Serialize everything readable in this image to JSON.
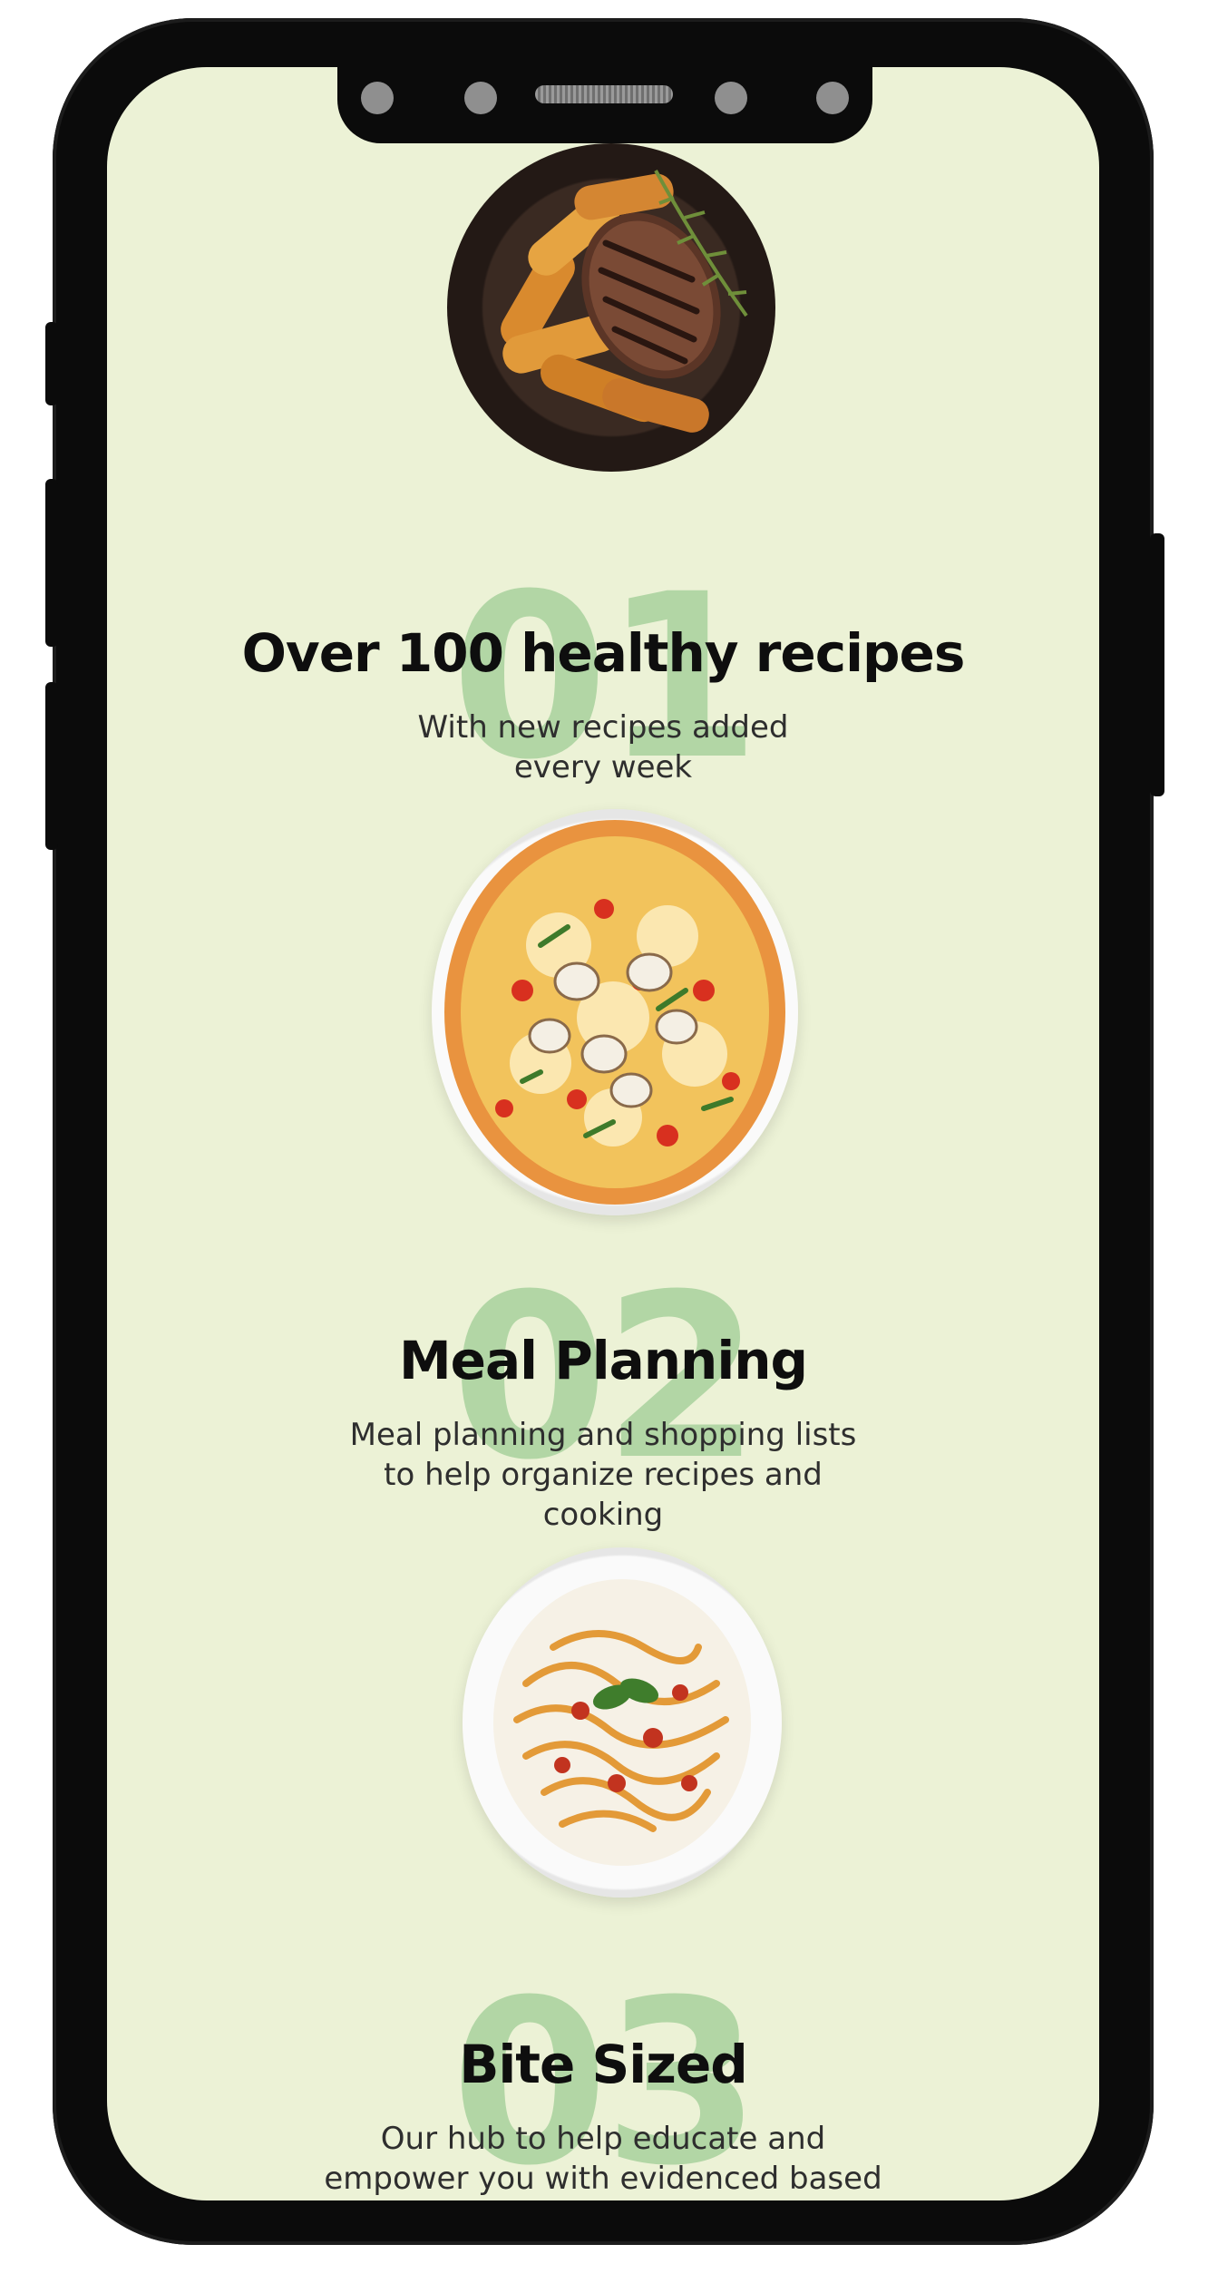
{
  "features": [
    {
      "number": "01",
      "title": "Over 100 healthy recipes",
      "description": "With new recipes added every week",
      "image": "steak-potatoes-dish"
    },
    {
      "number": "02",
      "title": "Meal Planning",
      "description": "Meal planning and shopping lists to help organize recipes and cooking",
      "image": "pizza-dish"
    },
    {
      "number": "03",
      "title": "Bite Sized",
      "description": "Our hub to help educate and empower you with evidenced based nutrition",
      "image": "pasta-dish"
    }
  ],
  "colors": {
    "background": "#ecf2d6",
    "number_watermark": "#a8d29d",
    "title": "#0e0e0e",
    "description": "#2e2e2e"
  }
}
